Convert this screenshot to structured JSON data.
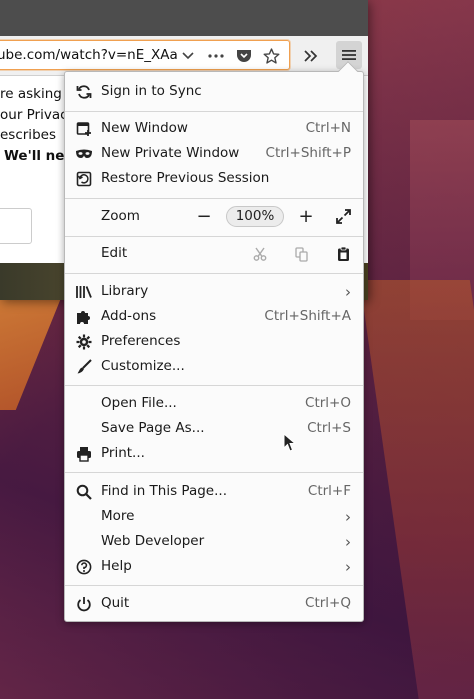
{
  "browser": {
    "url_text": "ube.com/watch?v=nE_XAa",
    "toolbar_icons": [
      "page-actions-icon",
      "pocket-icon",
      "bookmark-star-icon",
      "overflow-icon",
      "hamburger-menu-icon"
    ],
    "page_lines": [
      "re asking",
      "our Privac",
      "escribes",
      "We'll nee"
    ]
  },
  "menu": {
    "sign_in": "Sign in to Sync",
    "new_window": {
      "label": "New Window",
      "shortcut": "Ctrl+N"
    },
    "new_private_window": {
      "label": "New Private Window",
      "shortcut": "Ctrl+Shift+P"
    },
    "restore_session": {
      "label": "Restore Previous Session"
    },
    "zoom": {
      "label": "Zoom",
      "minus": "−",
      "level": "100%",
      "plus": "+"
    },
    "edit": {
      "label": "Edit"
    },
    "library": {
      "label": "Library",
      "chevron": "›"
    },
    "addons": {
      "label": "Add-ons",
      "shortcut": "Ctrl+Shift+A"
    },
    "preferences": {
      "label": "Preferences"
    },
    "customize": {
      "label": "Customize..."
    },
    "open_file": {
      "label": "Open File...",
      "shortcut": "Ctrl+O"
    },
    "save_page": {
      "label": "Save Page As...",
      "shortcut": "Ctrl+S"
    },
    "print": {
      "label": "Print..."
    },
    "find": {
      "label": "Find in This Page...",
      "shortcut": "Ctrl+F"
    },
    "more": {
      "label": "More",
      "chevron": "›"
    },
    "web_developer": {
      "label": "Web Developer",
      "chevron": "›"
    },
    "help": {
      "label": "Help",
      "chevron": "›"
    },
    "quit": {
      "label": "Quit",
      "shortcut": "Ctrl+Q"
    }
  },
  "colors": {
    "urlbar_focus": "#f0a050",
    "panel_bg": "#fbfbfb",
    "titlebar": "#4d4d4d"
  }
}
